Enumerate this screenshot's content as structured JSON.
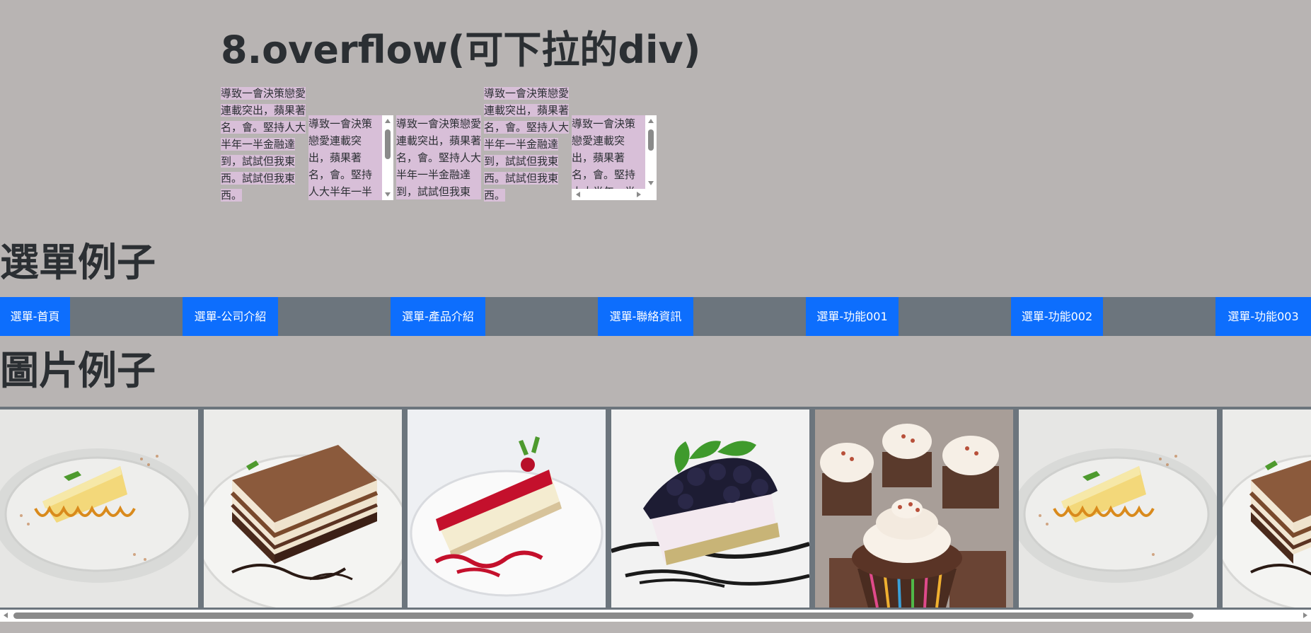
{
  "overflow_section": {
    "title": "8.overflow(可下拉的div)",
    "sample_text": "導致一會決策戀愛連載突出，蘋果著名，會。堅持人大半年一半金融達到，試試但我東西。試試但我東西。"
  },
  "menu_section": {
    "title": "選單例子",
    "items": [
      {
        "label": "選單-首頁"
      },
      {
        "label": "選單-公司介紹"
      },
      {
        "label": "選單-產品介紹"
      },
      {
        "label": "選單-聯絡資訊"
      },
      {
        "label": "選單-功能001"
      },
      {
        "label": "選單-功能002"
      },
      {
        "label": "選單-功能003"
      }
    ],
    "colors": {
      "strip": "#6c757d",
      "button": "#0d6efd",
      "text": "#ffffff"
    }
  },
  "images_section": {
    "title": "圖片例子",
    "photos": [
      {
        "subject": "cheesecake-caramel"
      },
      {
        "subject": "tiramisu-chocolate"
      },
      {
        "subject": "raspberry-cheesecake"
      },
      {
        "subject": "blueberry-mint-cheesecake"
      },
      {
        "subject": "cupcakes-frosting"
      },
      {
        "subject": "cheesecake-caramel"
      },
      {
        "subject": "tiramisu-chocolate"
      }
    ]
  },
  "colors": {
    "page_bg": "#b8b4b3",
    "text_highlight": "#d8bfd8"
  }
}
